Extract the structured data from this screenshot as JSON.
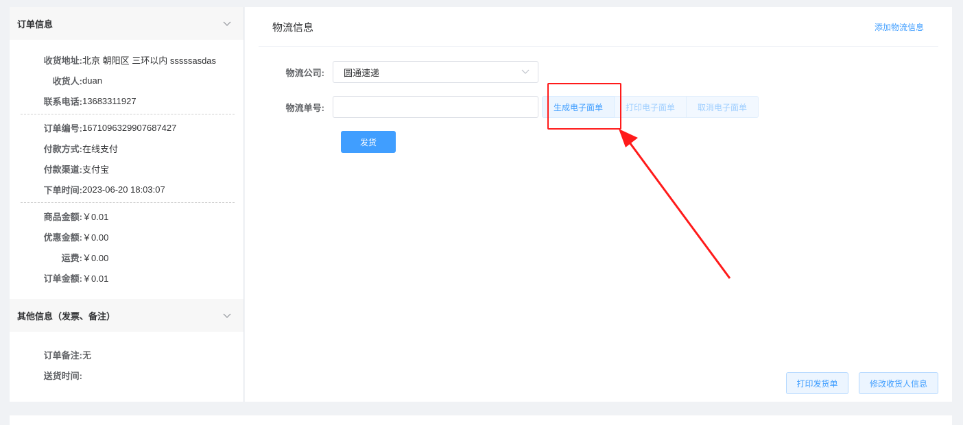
{
  "order_info": {
    "title": "订单信息",
    "address_label": "收货地址:",
    "address_value": "北京 朝阳区 三环以内 sssssasdas",
    "recipient_label": "收货人:",
    "recipient_value": "duan",
    "phone_label": "联系电话:",
    "phone_value": "13683311927",
    "order_no_label": "订单编号:",
    "order_no_value": "1671096329907687427",
    "pay_method_label": "付款方式:",
    "pay_method_value": "在线支付",
    "pay_channel_label": "付款渠道:",
    "pay_channel_value": "支付宝",
    "order_time_label": "下单时间:",
    "order_time_value": "2023-06-20 18:03:07",
    "goods_amount_label": "商品金额:",
    "goods_amount_value": "￥0.01",
    "discount_label": "优惠金额:",
    "discount_value": "￥0.00",
    "freight_label": "运费:",
    "freight_value": "￥0.00",
    "total_label": "订单金额:",
    "total_value": "￥0.01"
  },
  "other_info": {
    "title": "其他信息（发票、备注）",
    "remark_label": "订单备注:",
    "remark_value": "无",
    "delivery_time_label": "送货时间:",
    "delivery_time_value": ""
  },
  "logistics": {
    "title": "物流信息",
    "add_link": "添加物流信息",
    "company_label": "物流公司:",
    "company_value": "圆通速递",
    "tracking_label": "物流单号:",
    "tracking_value": "",
    "generate_btn": "生成电子面单",
    "print_btn": "打印电子面单",
    "cancel_btn": "取消电子面单",
    "ship_btn": "发货",
    "print_ship_btn": "打印发货单",
    "edit_recipient_btn": "修改收货人信息"
  },
  "colors": {
    "accent": "#409eff",
    "annotation": "#ff1a1a"
  }
}
